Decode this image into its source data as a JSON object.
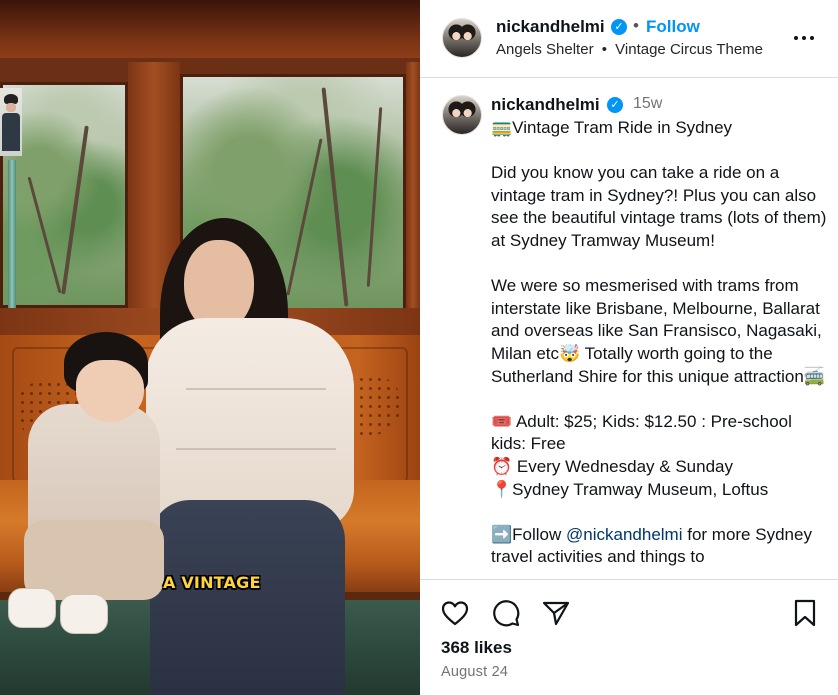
{
  "media": {
    "caption_overlay": "A VINTAGE"
  },
  "header": {
    "username": "nickandhelmi",
    "separator": "•",
    "follow_label": "Follow",
    "location": "Angels Shelter",
    "location_separator": "•",
    "audio": "Vintage Circus Theme",
    "more_icon": "more-horizontal-icon"
  },
  "caption": {
    "username": "nickandhelmi",
    "time_ago": "15w",
    "title": "🚃Vintage Tram Ride in Sydney",
    "para1": "Did you know you can take a ride on a vintage tram in Sydney?! Plus you can also see the beautiful vintage trams (lots of them) at Sydney Tramway Museum!",
    "para2": "We were so mesmerised with trams from interstate like Brisbane, Melbourne, Ballarat and overseas like San Fransisco, Nagasaki, Milan etc🤯 Totally worth going to the Sutherland Shire for this unique attraction🚎",
    "line_price": "🎟️ Adult: $25; Kids: $12.50 : Pre-school kids: Free",
    "line_days": "⏰ Every Wednesday & Sunday",
    "line_place": "📍Sydney Tramway Museum, Loftus",
    "follow_prefix": "➡️Follow ",
    "follow_mention": "@nickandhelmi",
    "follow_suffix": " for more Sydney travel activities and things to"
  },
  "actions": {
    "icons": [
      "heart-icon",
      "comment-icon",
      "share-icon",
      "bookmark-icon"
    ],
    "likes": "368 likes",
    "date": "August 24"
  },
  "colors": {
    "accent": "#0095f6",
    "verified": "#0095f6",
    "mention": "#00376b",
    "muted": "#737373",
    "caption_overlay": "#ffd43b"
  }
}
